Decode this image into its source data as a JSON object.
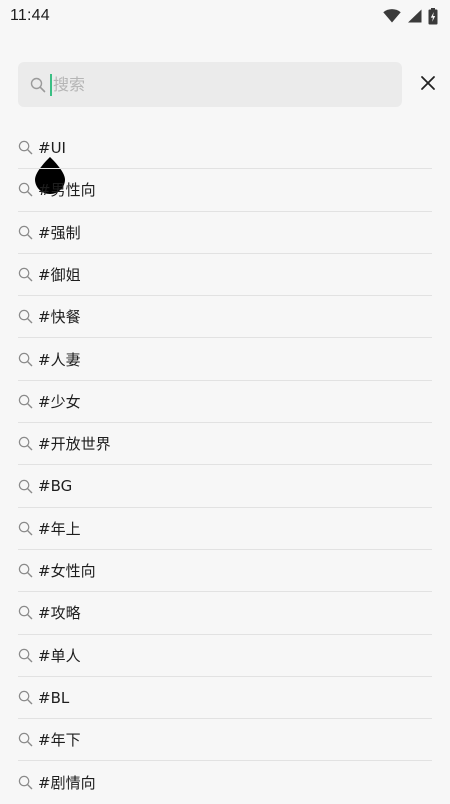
{
  "status_bar": {
    "time": "11:44",
    "icons": [
      "wifi-icon",
      "cellular-signal-icon",
      "battery-charging-icon"
    ]
  },
  "search": {
    "placeholder": "搜索",
    "value": "",
    "icon": "search-icon",
    "close_icon": "close-icon"
  },
  "tags": [
    {
      "label": "#UI"
    },
    {
      "label": "#男性向"
    },
    {
      "label": "#强制"
    },
    {
      "label": "#御姐"
    },
    {
      "label": "#快餐"
    },
    {
      "label": "#人妻"
    },
    {
      "label": "#少女"
    },
    {
      "label": "#开放世界"
    },
    {
      "label": "#BG"
    },
    {
      "label": "#年上"
    },
    {
      "label": "#女性向"
    },
    {
      "label": "#攻略"
    },
    {
      "label": "#单人"
    },
    {
      "label": "#BL"
    },
    {
      "label": "#年下"
    },
    {
      "label": "#剧情向"
    }
  ],
  "colors": {
    "background": "#f7f7f7",
    "search_box": "#ebebeb",
    "cursor": "#3bbf84",
    "divider": "#e2e2e2"
  }
}
